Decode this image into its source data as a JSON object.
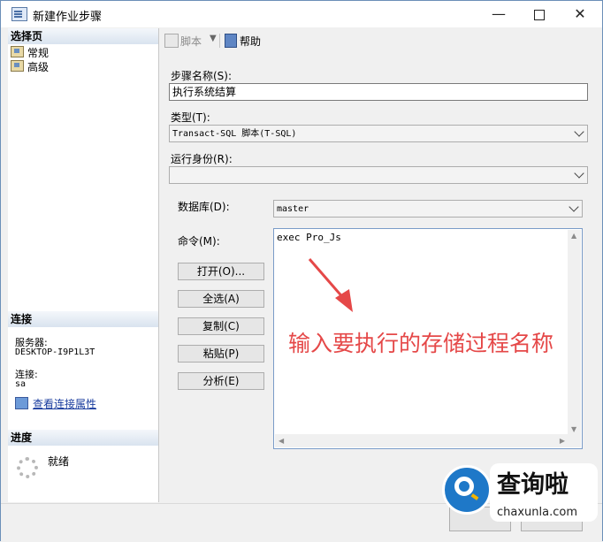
{
  "window": {
    "title": "新建作业步骤",
    "controls": {
      "minimize": "—",
      "close": "✕"
    }
  },
  "sidebar": {
    "pages_header": "选择页",
    "pages": [
      {
        "label": "常规"
      },
      {
        "label": "高级"
      }
    ],
    "connection_header": "连接",
    "server_label": "服务器:",
    "server_value": "DESKTOP-I9P1L3T",
    "connection_label": "连接:",
    "connection_value": "sa",
    "view_connection_link": "查看连接属性",
    "progress_header": "进度",
    "progress_status": "就绪"
  },
  "toolbar": {
    "script_label": "脚本",
    "help_label": "帮助"
  },
  "form": {
    "step_name_label": "步骤名称(S):",
    "step_name_value": "执行系统结算",
    "type_label": "类型(T):",
    "type_value": "Transact-SQL 脚本(T-SQL)",
    "run_as_label": "运行身份(R):",
    "run_as_value": "",
    "database_label": "数据库(D):",
    "database_value": "master",
    "command_label": "命令(M):",
    "command_value": "exec Pro_Js",
    "buttons": {
      "open": "打开(O)...",
      "select_all": "全选(A)",
      "copy": "复制(C)",
      "paste": "粘贴(P)",
      "parse": "分析(E)"
    }
  },
  "annotation": {
    "text": "输入要执行的存储过程名称",
    "color": "#e54848"
  },
  "watermark": {
    "title": "查询啦",
    "site": "chaxunla.com"
  },
  "colors": {
    "accent": "#1e78c8",
    "annotation": "#e54848"
  }
}
